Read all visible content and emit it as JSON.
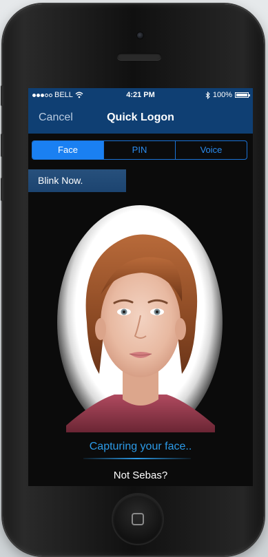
{
  "status_bar": {
    "carrier": "BELL",
    "time": "4:21 PM",
    "battery": "100%",
    "signal_bars_filled": 3,
    "signal_bars_total": 5
  },
  "nav": {
    "cancel_label": "Cancel",
    "title": "Quick Logon"
  },
  "auth_tabs": {
    "active": "Face",
    "items": [
      {
        "label": "Face"
      },
      {
        "label": "PIN"
      },
      {
        "label": "Voice"
      }
    ]
  },
  "instruction": {
    "text": "Blink Now."
  },
  "capture": {
    "status_text": "Capturing your face.."
  },
  "footer": {
    "not_user_label": "Not Sebas?"
  },
  "colors": {
    "nav_bg": "#0f3f73",
    "accent": "#1a80f2",
    "capture_text": "#2c9be8",
    "screen_bg": "#0b0b0b"
  },
  "icons": {
    "wifi": "wifi-icon",
    "bluetooth": "bluetooth-icon",
    "battery": "battery-icon",
    "home": "home-square-icon"
  }
}
